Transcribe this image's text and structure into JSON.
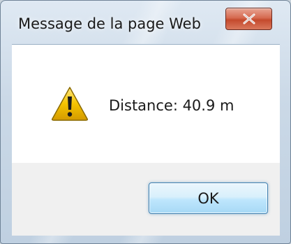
{
  "window": {
    "title": "Message de la page Web",
    "close_icon": "close-icon"
  },
  "dialog": {
    "icon": "warning-icon",
    "message": "Distance: 40.9 m",
    "ok_label": "OK"
  },
  "colors": {
    "close_button": "#c44a2d",
    "ok_button_border": "#3c7fb1",
    "warning_fill": "#f5c400"
  }
}
